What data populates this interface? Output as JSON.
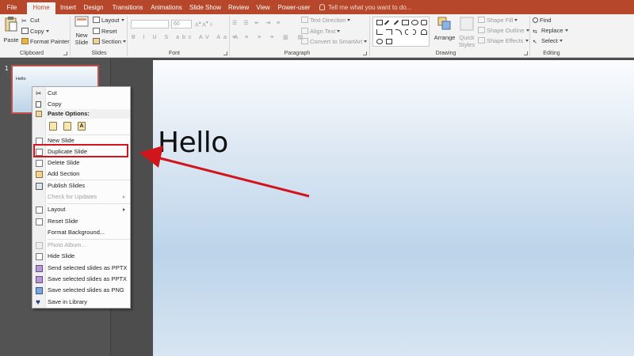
{
  "colors": {
    "accent": "#b7472a",
    "annotation": "#d0161c",
    "slide_gradient_bottom": "#bcd4ea"
  },
  "tabs": [
    "File",
    "Home",
    "Insert",
    "Design",
    "Transitions",
    "Animations",
    "Slide Show",
    "Review",
    "View",
    "Power-user"
  ],
  "active_tab": "Home",
  "tell_me": "Tell me what you want to do...",
  "ribbon": {
    "clipboard": {
      "paste": "Paste",
      "cut": "Cut",
      "copy": "Copy",
      "format_painter": "Format Painter",
      "label": "Clipboard"
    },
    "slides": {
      "new_slide": "New",
      "new_slide_2": "Slide",
      "layout": "Layout",
      "reset": "Reset",
      "section": "Section",
      "label": "Slides"
    },
    "font": {
      "size_value": "60",
      "label": "Font"
    },
    "paragraph": {
      "text_direction": "Text Direction",
      "align_text": "Align Text",
      "convert": "Convert to SmartArt",
      "label": "Paragraph"
    },
    "drawing": {
      "arrange": "Arrange",
      "quick_styles": "Quick",
      "quick_styles_2": "Styles",
      "shape_fill": "Shape Fill",
      "shape_outline": "Shape Outline",
      "shape_effects": "Shape Effects",
      "label": "Drawing"
    },
    "editing": {
      "find": "Find",
      "replace": "Replace",
      "select": "Select",
      "label": "Editing"
    }
  },
  "thumbnail": {
    "number": "1",
    "text": "Hello"
  },
  "slide": {
    "title": "Hello"
  },
  "context_menu": {
    "cut": "Cut",
    "copy": "Copy",
    "paste_options": "Paste Options:",
    "new_slide": "New Slide",
    "duplicate_slide": "Duplicate Slide",
    "delete_slide": "Delete Slide",
    "add_section": "Add Section",
    "publish_slides": "Publish Slides",
    "check_for_updates": "Check for Updates",
    "layout": "Layout",
    "reset_slide": "Reset Slide",
    "format_background": "Format Background...",
    "photo_album": "Photo Album...",
    "hide_slide": "Hide Slide",
    "send_pptx": "Send selected slides as PPTX",
    "save_pptx": "Save selected slides as PPTX",
    "save_png": "Save selected slides as PNG",
    "save_library": "Save in Library"
  }
}
